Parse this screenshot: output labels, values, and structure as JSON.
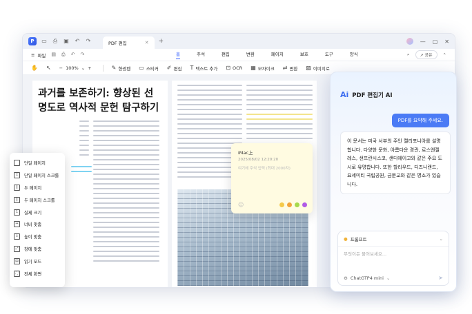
{
  "window": {
    "tab_title": "PDF 편집",
    "file_menu": "파일",
    "share_label": "공유"
  },
  "menus": [
    "홈",
    "주석",
    "편집",
    "변환",
    "페이지",
    "보호",
    "도구",
    "양식"
  ],
  "toolbar": {
    "zoom": "100%",
    "tools": [
      "형광펜",
      "스티커",
      "편집",
      "텍스트 추가",
      "OCR",
      "모자이크",
      "변환",
      "이미지로",
      "분할",
      "AI 도구"
    ]
  },
  "document": {
    "title": "과거를 보존하기: 향상된 선명도로 역사적 문헌 탐구하기"
  },
  "sticky_note": {
    "title": "iMac上",
    "date": "2025/08/02 12:20:20",
    "placeholder": "여기에 주석 입력 (최대 2000자)",
    "colors": [
      "#f5c948",
      "#f2a33a",
      "#a7d94b",
      "#b15ae6"
    ]
  },
  "side_menu": {
    "items": [
      "단일 페이지",
      "단일 페이지 스크롤",
      "두 페이지",
      "두 페이지 스크롤",
      "실제 크기",
      "너비 맞춤",
      "높이 맞춤",
      "창에 맞춤",
      "읽기 모드",
      "전체 화면"
    ]
  },
  "ai_panel": {
    "title": "PDF 편집기 AI",
    "user_message": "PDF를 요약해 주세요.",
    "ai_response": "이 문서는 미국 서부의 주인 캘리포니아를 설명합니다. 다양한 문화, 아름다운 경관, 로스앤젤레스, 샌프란시스코, 샌디에이고와 같은 주요 도시로 유명합니다. 또한 할리우드, 디즈니랜드, 요세미티 국립공원, 금문교와 같은 명소가 있습니다.",
    "prompt_label": "프롬프트",
    "input_placeholder": "무엇이든 물어보세요...",
    "model": "ChatGTP4 mini"
  }
}
